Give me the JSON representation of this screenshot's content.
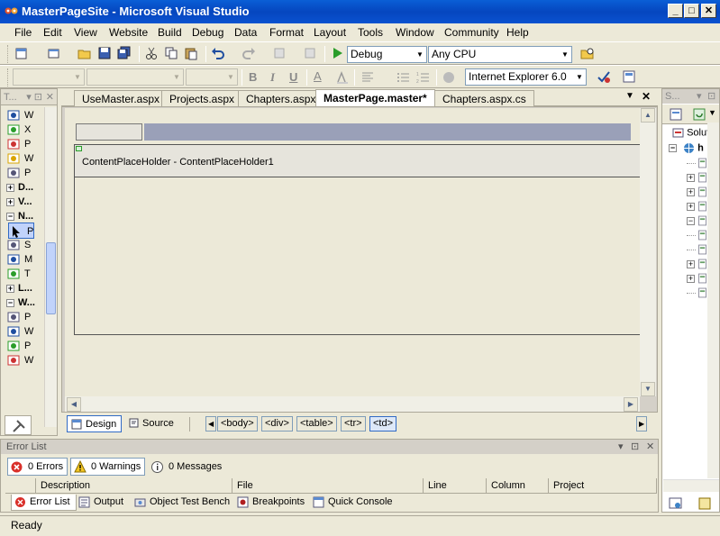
{
  "window": {
    "title": "MasterPageSite - Microsoft Visual Studio"
  },
  "menu": [
    "File",
    "Edit",
    "View",
    "Website",
    "Build",
    "Debug",
    "Data",
    "Format",
    "Layout",
    "Tools",
    "Window",
    "Community",
    "Help"
  ],
  "toolbar": {
    "config": "Debug",
    "platform": "Any CPU",
    "browser": "Internet Explorer 6.0"
  },
  "toolbox": {
    "title": "T...",
    "rows": [
      {
        "label": "W",
        "bold": false
      },
      {
        "label": "X",
        "bold": false
      },
      {
        "label": "P",
        "bold": false
      },
      {
        "label": "W",
        "bold": false
      },
      {
        "label": "P",
        "bold": false
      },
      {
        "label": "D...",
        "bold": true
      },
      {
        "label": "V...",
        "bold": true
      },
      {
        "label": "N...",
        "bold": true
      },
      {
        "label": "P",
        "bold": false
      },
      {
        "label": "S",
        "bold": false
      },
      {
        "label": "M",
        "bold": false
      },
      {
        "label": "T",
        "bold": false
      },
      {
        "label": "L...",
        "bold": true
      },
      {
        "label": "W...",
        "bold": true
      },
      {
        "label": "P",
        "bold": false
      },
      {
        "label": "W",
        "bold": false
      },
      {
        "label": "P",
        "bold": false
      },
      {
        "label": "W",
        "bold": false
      }
    ]
  },
  "tabs": [
    "UseMaster.aspx",
    "Projects.aspx",
    "Chapters.aspx",
    "MasterPage.master*",
    "Chapters.aspx.cs"
  ],
  "designer": {
    "placeholder": "ContentPlaceHolder - ContentPlaceHolder1"
  },
  "viewbar": {
    "design": "Design",
    "source": "Source",
    "tags": [
      "<body>",
      "<div>",
      "<table>",
      "<tr>",
      "<td>"
    ]
  },
  "errorlist": {
    "title": "Error List",
    "errors": "0 Errors",
    "warnings": "0 Warnings",
    "messages": "0 Messages",
    "columns": [
      "Description",
      "File",
      "Line",
      "Column",
      "Project"
    ]
  },
  "bottomtabs": [
    "Error List",
    "Output",
    "Object Test Bench",
    "Breakpoints",
    "Quick Console"
  ],
  "solution": {
    "title": "S...",
    "root": "Soluti",
    "project": "h"
  },
  "status": "Ready"
}
